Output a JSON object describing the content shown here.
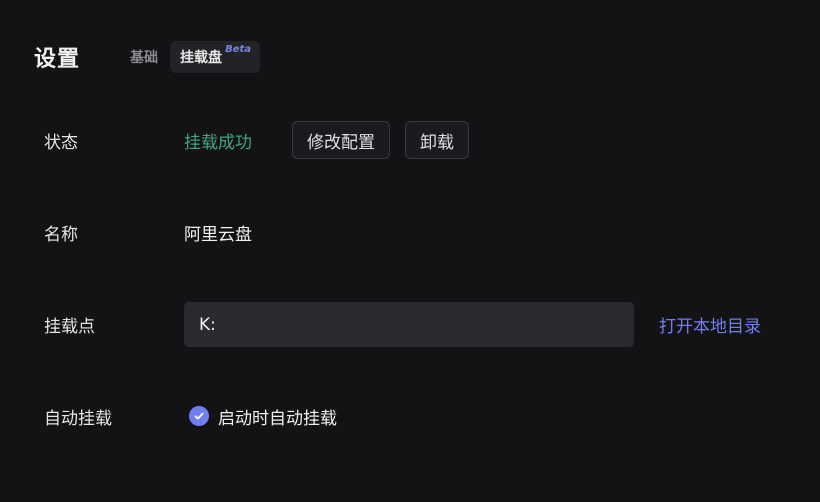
{
  "header": {
    "title": "设置",
    "tabs": [
      {
        "label": "基础",
        "active": false
      },
      {
        "label": "挂载盘",
        "active": true,
        "badge": "Beta"
      }
    ]
  },
  "status_row": {
    "label": "状态",
    "status": "挂载成功",
    "status_color": "#3fa57a",
    "edit_button": "修改配置",
    "unmount_button": "卸载"
  },
  "name_row": {
    "label": "名称",
    "value": "阿里云盘"
  },
  "mount_row": {
    "label": "挂载点",
    "value": "K:",
    "open_link": "打开本地目录",
    "link_color": "#6f7ff0"
  },
  "auto_row": {
    "label": "自动挂载",
    "checkbox_checked": true,
    "checkbox_label": "启动时自动挂载",
    "checkbox_icon": "check-icon"
  }
}
